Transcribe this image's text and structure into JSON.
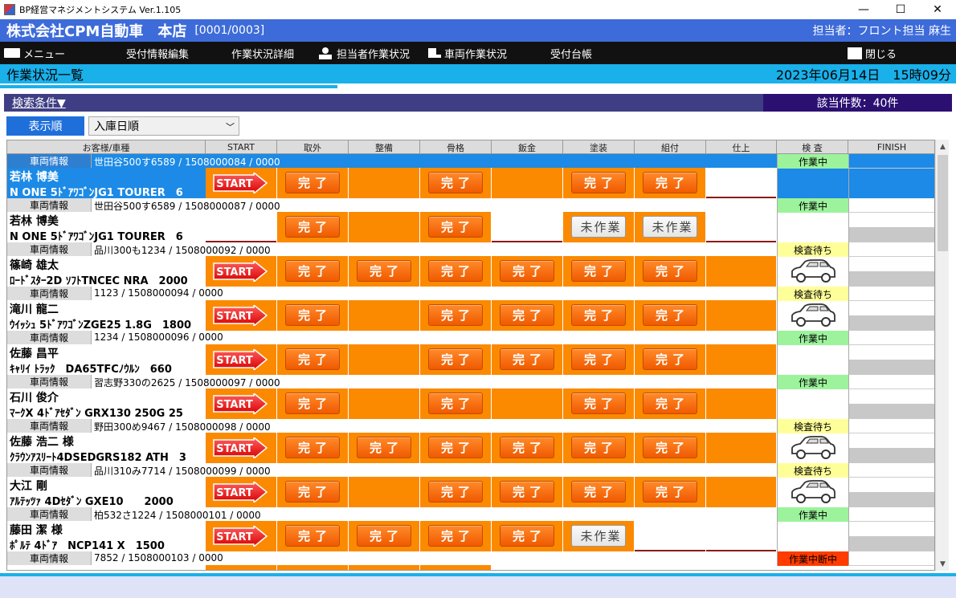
{
  "window": {
    "title": "BP経営マネジメントシステム Ver.1.105",
    "minimize": "—",
    "maximize": "☐",
    "close": "✕"
  },
  "header": {
    "company": "株式会社CPM自動車　本店",
    "code": "[0001/0003]",
    "staff": "担当者：フロント担当 麻生"
  },
  "toolbar": {
    "menu": "メニュー",
    "reception_edit": "受付情報編集",
    "work_detail": "作業状況詳細",
    "staff_status": "担当者作業状況",
    "vehicle_status": "車両作業状況",
    "ledger": "受付台帳",
    "close": "閉じる"
  },
  "subheader": {
    "title": "作業状況一覧",
    "datetime": "2023年06月14日　15時09分"
  },
  "search": {
    "label": "検索条件▼",
    "count": "該当件数：40件"
  },
  "sort": {
    "label": "表示順",
    "value": "入庫日順"
  },
  "columns": [
    "お客様/車種",
    "START",
    "取外",
    "整備",
    "骨格",
    "鈑金",
    "塗装",
    "組付",
    "仕上",
    "検 査",
    "FINISH"
  ],
  "vehicle_label": "車両情報",
  "start_label": "START",
  "done_label": "完了",
  "notyet_label": "未作業",
  "rows": [
    {
      "vinfo": "世田谷500す6589 / 1508000084 / 0000",
      "name": "若林 博美",
      "car": "N ONE 5ﾄﾞｱﾜｺﾞﾝJG1 TOURER　6",
      "status": "作業中"
    },
    {
      "vinfo": "世田谷500す6589 / 1508000087 / 0000",
      "name": "若林 博美",
      "car": "N ONE 5ﾄﾞｱﾜｺﾞﾝJG1 TOURER　6",
      "status": "作業中"
    },
    {
      "vinfo": "品川300も1234 / 1508000092 / 0000",
      "name": "篠崎 雄太",
      "car": "ﾛｰﾄﾞｽﾀｰ2D ｿﾌﾄTNCEC NRA　2000",
      "status": "検査待ち"
    },
    {
      "vinfo": "1123 / 1508000094 / 0000",
      "name": "滝川 龍二",
      "car": "ｳｲｯｼｭ 5ﾄﾞｱﾜｺﾞﾝZGE25 1.8G　1800",
      "status": "検査待ち"
    },
    {
      "vinfo": "1234 / 1508000096 / 0000",
      "name": "佐藤 昌平",
      "car": "ｷｬﾘｲ ﾄﾗｯｸ　DA65TFCﾉｳﾙﾝ　660",
      "status": "作業中"
    },
    {
      "vinfo": "習志野330の2625 / 1508000097 / 0000",
      "name": "石川 俊介",
      "car": "ﾏｰｸX 4ﾄﾞｱｾﾀﾞﾝ GRX130 250G 25",
      "status": "作業中"
    },
    {
      "vinfo": "野田300め9467 / 1508000098 / 0000",
      "name": "佐藤 浩二 様",
      "car": "ｸﾗｳﾝｱｽﾘｰﾄ4DSEDGRS182 ATH　3",
      "status": "検査待ち"
    },
    {
      "vinfo": "品川310み7714 / 1508000099 / 0000",
      "name": "大江 剛",
      "car": "ｱﾙﾃｯﾂｧ 4Dｾﾀﾞﾝ GXE10　　2000",
      "status": "検査待ち"
    },
    {
      "vinfo": "柏532さ1224 / 1508000101 / 0000",
      "name": "藤田 潔 様",
      "car": "ﾎﾟﾙﾃ 4ﾄﾞｱ　NCP141 X　1500",
      "status": "作業中"
    },
    {
      "vinfo": "7852 / 1508000103 / 0000",
      "name": "",
      "car": "",
      "status": "作業中断中"
    }
  ],
  "colors": {
    "orange": "#fb8a00",
    "working": "#9cf39c",
    "waiting": "#ffff99",
    "suspended": "#ff3b00"
  }
}
